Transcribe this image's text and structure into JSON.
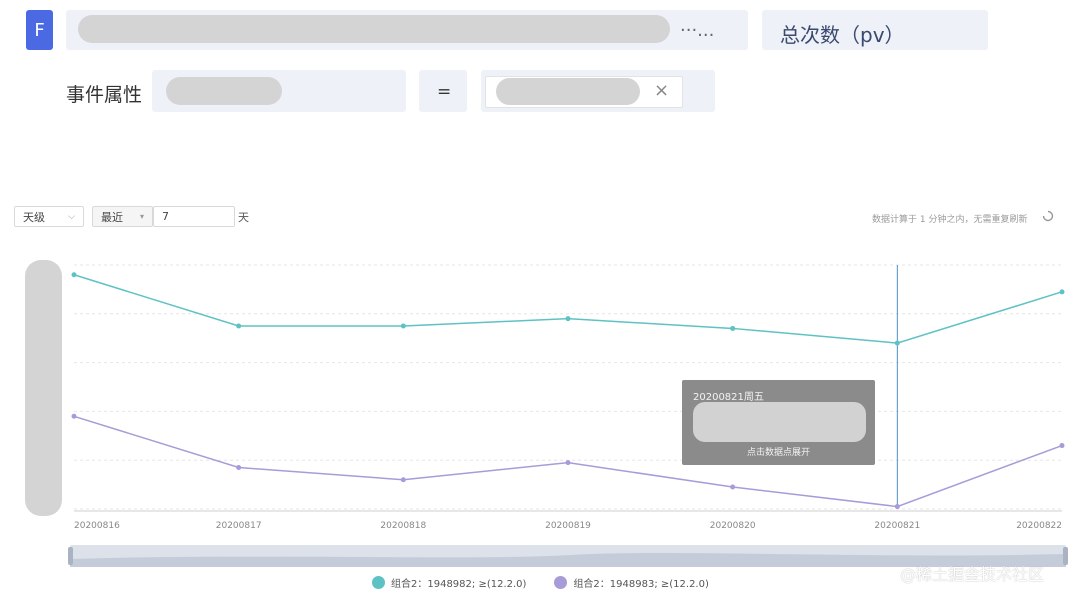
{
  "filter": {
    "badge": "F",
    "ellipsis": "···...",
    "metric": "总次数（pv）",
    "property_label": "事件属性",
    "operator": "=",
    "clear_icon": "×"
  },
  "controls": {
    "granularity": "天级",
    "range_mode": "最近",
    "range_value": "7",
    "range_unit": "天",
    "note": "数据计算于 1 分钟之内，无需重复刷新"
  },
  "tooltip": {
    "date": "20200821周五",
    "hint": "点击数据点展开"
  },
  "watermark": "@稀土掘金技术社区",
  "chart_data": {
    "type": "line",
    "categories": [
      "20200816",
      "20200817",
      "20200818",
      "20200819",
      "20200820",
      "20200821",
      "20200822"
    ],
    "series": [
      {
        "name": "组合2：1948982; ≥(12.2.0)",
        "color": "#5ec2c4",
        "values": [
          96,
          75,
          75,
          78,
          74,
          68,
          89
        ]
      },
      {
        "name": "组合2：1948983; ≥(12.2.0)",
        "color": "#a99bd8",
        "values": [
          38,
          17,
          12,
          19,
          9,
          1,
          26
        ]
      }
    ],
    "ylim": [
      0,
      100
    ],
    "grid": true,
    "highlight_category": "20200821",
    "legend_position": "bottom"
  }
}
